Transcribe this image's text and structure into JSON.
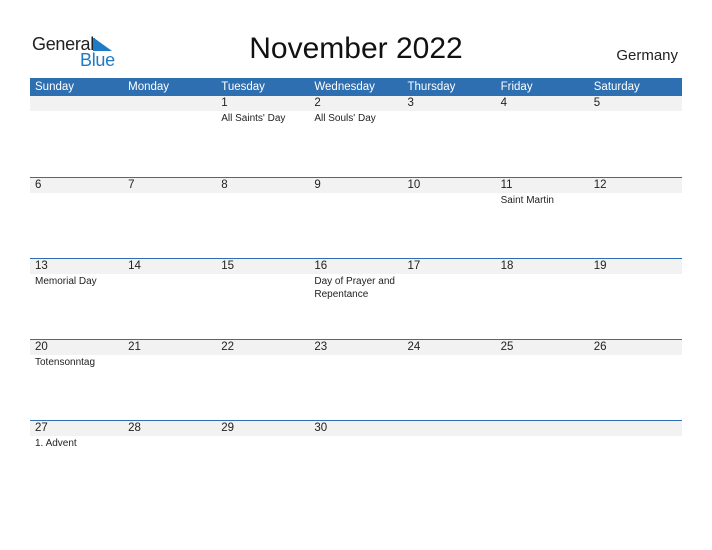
{
  "logo": {
    "general": "General",
    "blue": "Blue",
    "brand_color": "#1e7bc6"
  },
  "header": {
    "title": "November 2022",
    "country": "Germany"
  },
  "colors": {
    "header_bg": "#2d6fb0",
    "daynum_bg": "#f2f2f2"
  },
  "weekdays": [
    "Sunday",
    "Monday",
    "Tuesday",
    "Wednesday",
    "Thursday",
    "Friday",
    "Saturday"
  ],
  "weeks": [
    {
      "days": [
        {
          "num": "",
          "event": ""
        },
        {
          "num": "",
          "event": ""
        },
        {
          "num": "1",
          "event": "All Saints' Day"
        },
        {
          "num": "2",
          "event": "All Souls' Day"
        },
        {
          "num": "3",
          "event": ""
        },
        {
          "num": "4",
          "event": ""
        },
        {
          "num": "5",
          "event": ""
        }
      ]
    },
    {
      "days": [
        {
          "num": "6",
          "event": ""
        },
        {
          "num": "7",
          "event": ""
        },
        {
          "num": "8",
          "event": ""
        },
        {
          "num": "9",
          "event": ""
        },
        {
          "num": "10",
          "event": ""
        },
        {
          "num": "11",
          "event": "Saint Martin"
        },
        {
          "num": "12",
          "event": ""
        }
      ]
    },
    {
      "days": [
        {
          "num": "13",
          "event": "Memorial Day"
        },
        {
          "num": "14",
          "event": ""
        },
        {
          "num": "15",
          "event": ""
        },
        {
          "num": "16",
          "event": "Day of Prayer and Repentance"
        },
        {
          "num": "17",
          "event": ""
        },
        {
          "num": "18",
          "event": ""
        },
        {
          "num": "19",
          "event": ""
        }
      ]
    },
    {
      "days": [
        {
          "num": "20",
          "event": "Totensonntag"
        },
        {
          "num": "21",
          "event": ""
        },
        {
          "num": "22",
          "event": ""
        },
        {
          "num": "23",
          "event": ""
        },
        {
          "num": "24",
          "event": ""
        },
        {
          "num": "25",
          "event": ""
        },
        {
          "num": "26",
          "event": ""
        }
      ]
    },
    {
      "days": [
        {
          "num": "27",
          "event": "1. Advent"
        },
        {
          "num": "28",
          "event": ""
        },
        {
          "num": "29",
          "event": ""
        },
        {
          "num": "30",
          "event": ""
        },
        {
          "num": "",
          "event": ""
        },
        {
          "num": "",
          "event": ""
        },
        {
          "num": "",
          "event": ""
        }
      ]
    }
  ]
}
